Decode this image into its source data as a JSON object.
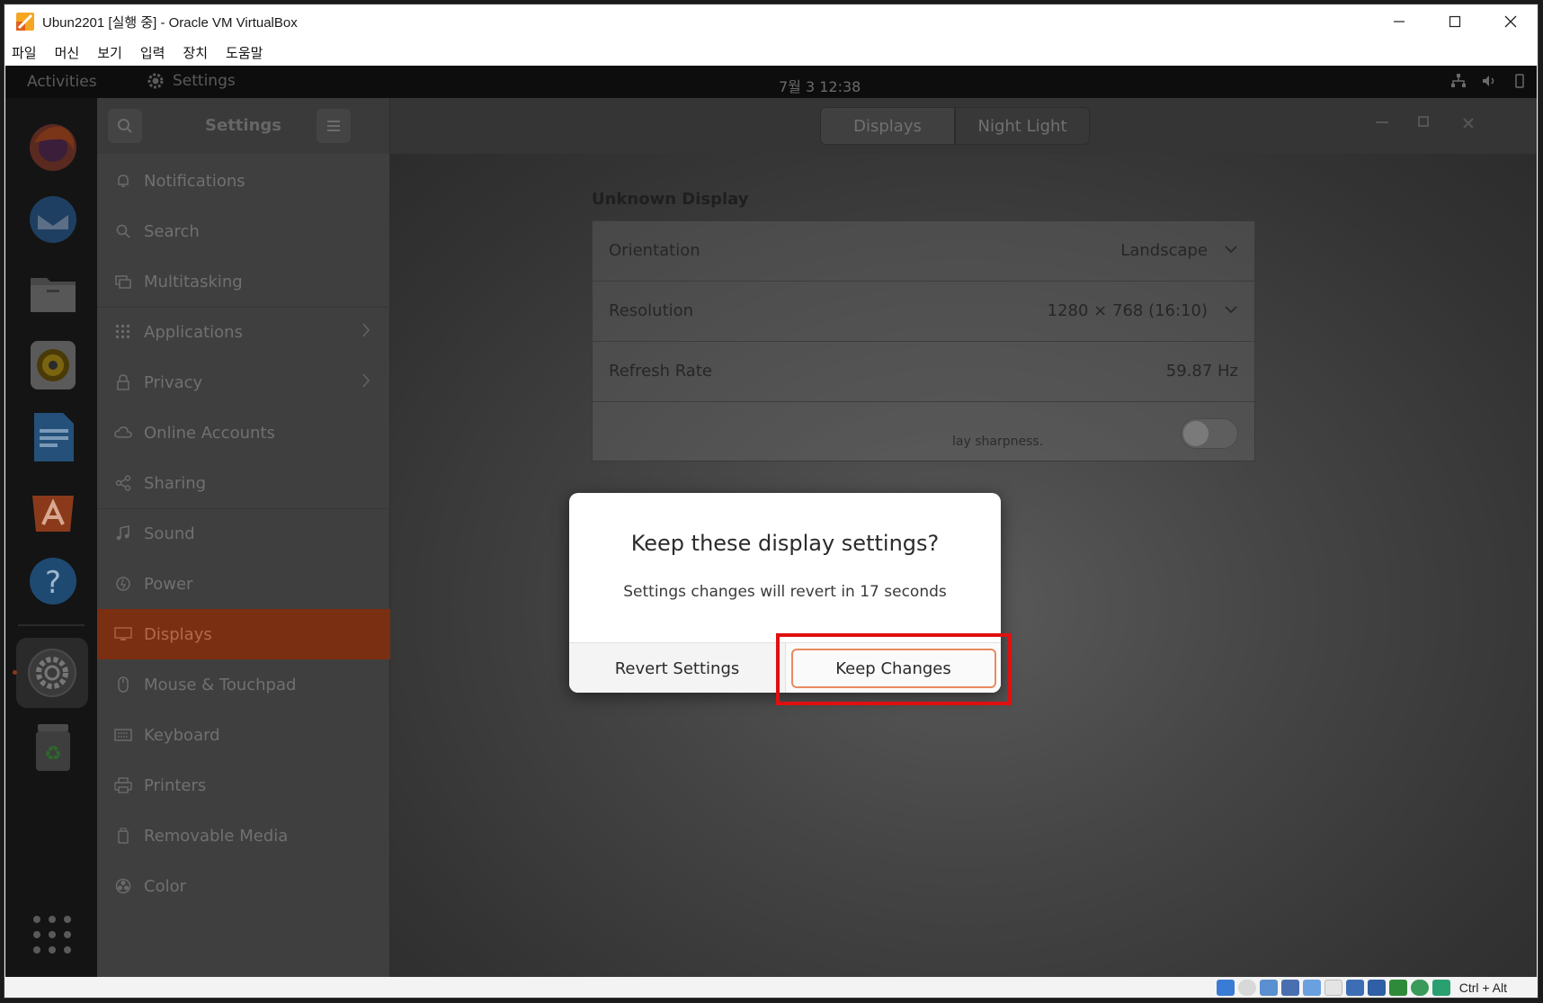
{
  "vbox": {
    "title": "Ubun2201 [실행 중] - Oracle VM VirtualBox",
    "menu": [
      "파일",
      "머신",
      "보기",
      "입력",
      "장치",
      "도움말"
    ],
    "host_key": "Ctrl + Alt"
  },
  "topbar": {
    "activities": "Activities",
    "app_label": "Settings",
    "clock": "7월 3  12:38"
  },
  "settings": {
    "sidebar_title": "Settings",
    "tabs": [
      "Displays",
      "Night Light"
    ],
    "sidebar_items": [
      {
        "label": "Notifications",
        "icon": "bell-icon"
      },
      {
        "label": "Search",
        "icon": "search-icon"
      },
      {
        "label": "Multitasking",
        "icon": "multitasking-icon"
      },
      {
        "label": "Applications",
        "icon": "grid-icon"
      },
      {
        "label": "Privacy",
        "icon": "lock-icon"
      },
      {
        "label": "Online Accounts",
        "icon": "cloud-icon"
      },
      {
        "label": "Sharing",
        "icon": "share-icon"
      },
      {
        "label": "Sound",
        "icon": "music-note-icon"
      },
      {
        "label": "Power",
        "icon": "power-icon"
      },
      {
        "label": "Displays",
        "icon": "monitor-icon"
      },
      {
        "label": "Mouse & Touchpad",
        "icon": "mouse-icon"
      },
      {
        "label": "Keyboard",
        "icon": "keyboard-icon"
      },
      {
        "label": "Printers",
        "icon": "printer-icon"
      },
      {
        "label": "Removable Media",
        "icon": "usb-drive-icon"
      },
      {
        "label": "Color",
        "icon": "color-icon"
      }
    ],
    "active_item": "Displays",
    "display": {
      "name": "Unknown Display",
      "orientation_label": "Orientation",
      "orientation_value": "Landscape",
      "resolution_label": "Resolution",
      "resolution_value": "1280 × 768 (16:10)",
      "refresh_label": "Refresh Rate",
      "refresh_value": "59.87 Hz",
      "scale_hint": "lay sharpness."
    }
  },
  "dialog": {
    "title": "Keep these display settings?",
    "message": "Settings changes will revert in 17 seconds",
    "revert_label": "Revert Settings",
    "keep_label": "Keep Changes"
  },
  "colors": {
    "accent": "#e95420",
    "highlight_box": "#e01010"
  }
}
